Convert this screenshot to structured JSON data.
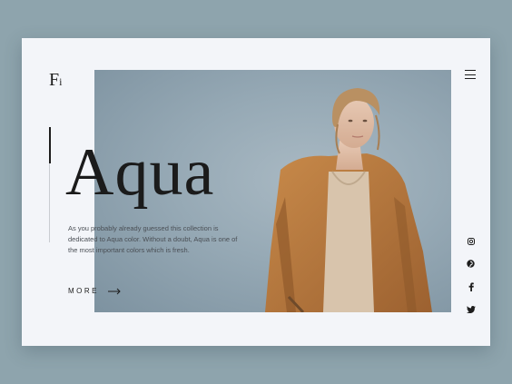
{
  "brand": {
    "logo_letter": "F",
    "logo_dot": "i"
  },
  "hero": {
    "title": "Aqua",
    "description": "As you probably already guessed this collection is dedicated to Aqua color. Without a doubt, Aqua is one of the most important colors which is fresh.",
    "cta_label": "MORE"
  },
  "colors": {
    "accent_coat": "#b87a3e",
    "background": "#8ea4ad",
    "card": "#f3f5f9"
  },
  "icons": {
    "menu": "hamburger-menu-icon",
    "social": [
      "instagram-icon",
      "pinterest-icon",
      "facebook-icon",
      "twitter-icon"
    ]
  }
}
